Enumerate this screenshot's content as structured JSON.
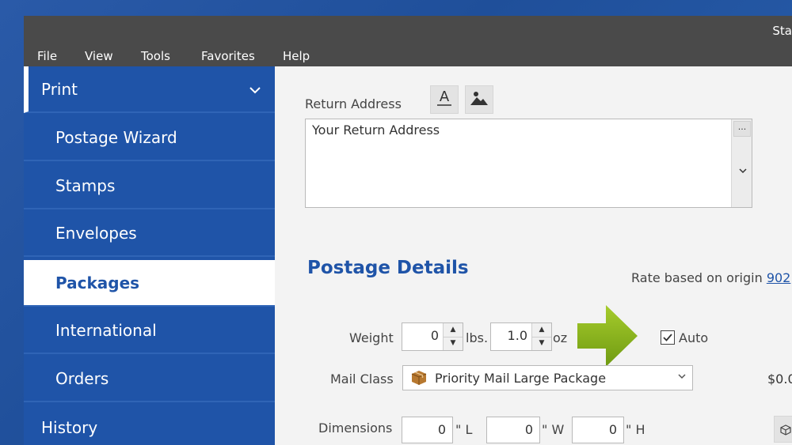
{
  "app": {
    "title_fragment": "Sta"
  },
  "menu": {
    "file": "File",
    "view": "View",
    "tools": "Tools",
    "favorites": "Favorites",
    "help": "Help"
  },
  "sidebar": {
    "items": [
      {
        "label": "Print",
        "level": "top",
        "active": false
      },
      {
        "label": "Postage Wizard",
        "level": "sub",
        "active": false
      },
      {
        "label": "Stamps",
        "level": "sub",
        "active": false
      },
      {
        "label": "Envelopes",
        "level": "sub",
        "active": false
      },
      {
        "label": "Packages",
        "level": "sub",
        "active": true
      },
      {
        "label": "International",
        "level": "sub",
        "active": false
      },
      {
        "label": "Orders",
        "level": "sub",
        "active": false
      },
      {
        "label": "History",
        "level": "top",
        "active": false
      }
    ]
  },
  "return_address": {
    "label": "Return Address",
    "value": "Your Return Address",
    "ellipsis": "..."
  },
  "postage_details": {
    "title": "Postage Details",
    "rate_prefix": "Rate based on origin ",
    "rate_link": "902",
    "weight_label": "Weight",
    "lbs_value": "0",
    "lbs_unit": "lbs.",
    "oz_value": "1.0",
    "oz_unit": "oz",
    "auto_label": "Auto",
    "auto_checked": true,
    "mail_class_label": "Mail Class",
    "mail_class_value": "Priority Mail Large Package",
    "price_fragment": "$0.0",
    "dimensions_label": "Dimensions",
    "dim_l": "0",
    "dim_w": "0",
    "dim_h": "0",
    "unit_l": "\" L",
    "unit_w": "\" W",
    "unit_h": "\" H"
  },
  "colors": {
    "accent": "#1f54a8",
    "arrow": "#8cb61e"
  },
  "icons": {
    "print_chevron": "chevron-down-icon",
    "text_format": "text-format-icon",
    "image": "image-icon",
    "package": "package-icon",
    "cube": "cube-icon"
  }
}
